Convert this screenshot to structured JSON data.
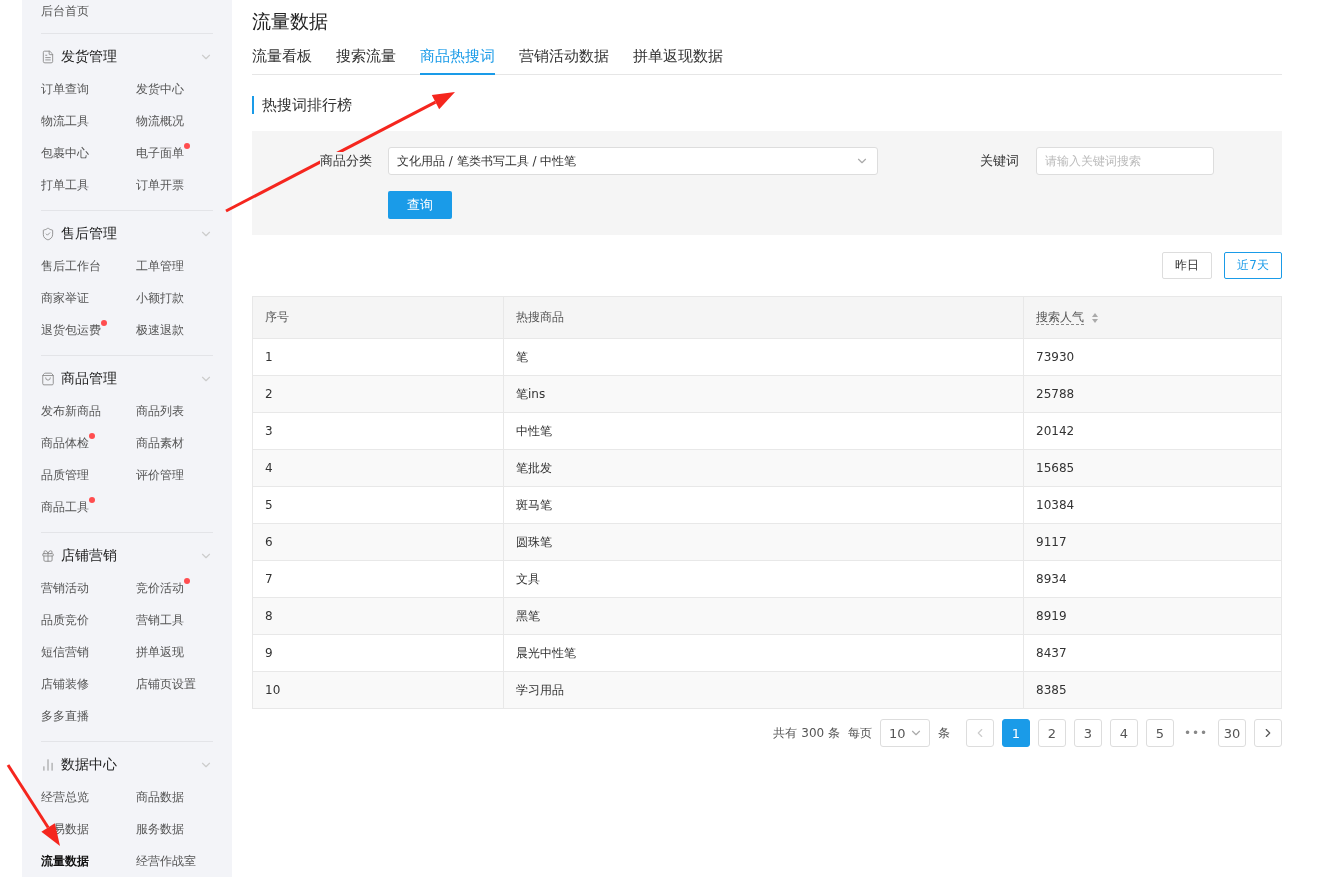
{
  "sidebar": {
    "home": "后台首页",
    "sections": [
      {
        "kind": "document",
        "title": "发货管理",
        "expanded": true,
        "items": [
          {
            "label": "订单查询",
            "dot": false,
            "selected": false
          },
          {
            "label": "发货中心",
            "dot": false,
            "selected": false
          },
          {
            "label": "物流工具",
            "dot": false,
            "selected": false
          },
          {
            "label": "物流概况",
            "dot": false,
            "selected": false
          },
          {
            "label": "包裹中心",
            "dot": false,
            "selected": false
          },
          {
            "label": "电子面单",
            "dot": true,
            "selected": false
          },
          {
            "label": "打单工具",
            "dot": false,
            "selected": false
          },
          {
            "label": "订单开票",
            "dot": false,
            "selected": false
          }
        ]
      },
      {
        "kind": "shield",
        "title": "售后管理",
        "expanded": true,
        "items": [
          {
            "label": "售后工作台",
            "dot": false,
            "selected": false
          },
          {
            "label": "工单管理",
            "dot": false,
            "selected": false
          },
          {
            "label": "商家举证",
            "dot": false,
            "selected": false
          },
          {
            "label": "小额打款",
            "dot": false,
            "selected": false
          },
          {
            "label": "退货包运费",
            "dot": true,
            "selected": false
          },
          {
            "label": "极速退款",
            "dot": false,
            "selected": false
          }
        ]
      },
      {
        "kind": "bag",
        "title": "商品管理",
        "expanded": true,
        "items": [
          {
            "label": "发布新商品",
            "dot": false,
            "selected": false
          },
          {
            "label": "商品列表",
            "dot": false,
            "selected": false
          },
          {
            "label": "商品体检",
            "dot": true,
            "selected": false
          },
          {
            "label": "商品素材",
            "dot": false,
            "selected": false
          },
          {
            "label": "品质管理",
            "dot": false,
            "selected": false
          },
          {
            "label": "评价管理",
            "dot": false,
            "selected": false
          },
          {
            "label": "商品工具",
            "dot": true,
            "selected": false
          }
        ]
      },
      {
        "kind": "gift",
        "title": "店铺营销",
        "expanded": true,
        "items": [
          {
            "label": "营销活动",
            "dot": false,
            "selected": false
          },
          {
            "label": "竞价活动",
            "dot": true,
            "selected": false
          },
          {
            "label": "品质竞价",
            "dot": false,
            "selected": false
          },
          {
            "label": "营销工具",
            "dot": false,
            "selected": false
          },
          {
            "label": "短信营销",
            "dot": false,
            "selected": false
          },
          {
            "label": "拼单返现",
            "dot": false,
            "selected": false
          },
          {
            "label": "店铺装修",
            "dot": false,
            "selected": false
          },
          {
            "label": "店铺页设置",
            "dot": false,
            "selected": false
          },
          {
            "label": "多多直播",
            "dot": false,
            "selected": false
          }
        ]
      },
      {
        "kind": "chart",
        "title": "数据中心",
        "expanded": true,
        "items": [
          {
            "label": "经营总览",
            "dot": false,
            "selected": false
          },
          {
            "label": "商品数据",
            "dot": false,
            "selected": false
          },
          {
            "label": "易数据",
            "dot": false,
            "selected": false
          },
          {
            "label": "服务数据",
            "dot": false,
            "selected": false
          },
          {
            "label": "流量数据",
            "dot": false,
            "selected": true
          },
          {
            "label": "经营作战室",
            "dot": false,
            "selected": false
          }
        ]
      }
    ]
  },
  "page_title": "流量数据",
  "tabs": [
    {
      "label": "流量看板",
      "selected": false
    },
    {
      "label": "搜索流量",
      "selected": false
    },
    {
      "label": "商品热搜词",
      "selected": true
    },
    {
      "label": "营销活动数据",
      "selected": false
    },
    {
      "label": "拼单返现数据",
      "selected": false
    }
  ],
  "section_title": "热搜词排行榜",
  "filter": {
    "category_label": "商品分类",
    "category_value": "文化用品 / 笔类书写工具 / 中性笔",
    "keyword_label": "关键词",
    "keyword_placeholder": "请输入关键词搜索",
    "query_button": "查询"
  },
  "date_range": [
    {
      "label": "昨日",
      "selected": false
    },
    {
      "label": "近7天",
      "selected": true
    }
  ],
  "table": {
    "columns": [
      "序号",
      "热搜商品",
      "搜索人气"
    ],
    "rows": [
      [
        "1",
        "笔",
        "73930"
      ],
      [
        "2",
        "笔ins",
        "25788"
      ],
      [
        "3",
        "中性笔",
        "20142"
      ],
      [
        "4",
        "笔批发",
        "15685"
      ],
      [
        "5",
        "斑马笔",
        "10384"
      ],
      [
        "6",
        "圆珠笔",
        "9117"
      ],
      [
        "7",
        "文具",
        "8934"
      ],
      [
        "8",
        "黑笔",
        "8919"
      ],
      [
        "9",
        "晨光中性笔",
        "8437"
      ],
      [
        "10",
        "学习用品",
        "8385"
      ]
    ]
  },
  "pagination": {
    "total": "共有 300 条",
    "per_page_label": "每页",
    "per_page": "10",
    "unit": "条",
    "pages": [
      {
        "label": "1",
        "selected": true
      },
      {
        "label": "2",
        "selected": false
      },
      {
        "label": "3",
        "selected": false
      },
      {
        "label": "4",
        "selected": false
      },
      {
        "label": "5",
        "selected": false
      },
      {
        "label": "•••",
        "kind": "ellipsis"
      },
      {
        "label": "30",
        "selected": false
      }
    ],
    "prev_disabled": true
  },
  "annotations": [
    {
      "kind": "arrow"
    },
    {
      "kind": "arrow"
    }
  ]
}
